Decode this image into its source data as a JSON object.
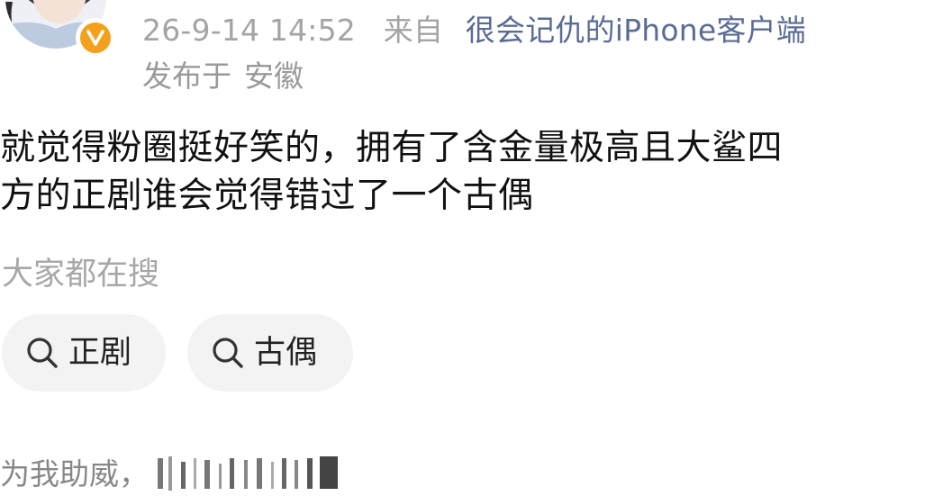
{
  "post_header": {
    "timestamp": "26-9-14 14:52",
    "from_label": "来自",
    "client": "很会记仇的iPhone客户端",
    "location_prefix": "发布于",
    "location": "安徽"
  },
  "avatar": {
    "badge_letter": "v",
    "badge_color": "#f5a01a"
  },
  "post": {
    "text_line_1": "就觉得粉圈挺好笑的，拥有了含金量极高且大鲨四",
    "text_line_2": "方的正剧谁会觉得错过了一个古偶"
  },
  "search_section": {
    "label": "大家都在搜",
    "chips": [
      {
        "label": "正剧",
        "icon": "search-icon"
      },
      {
        "label": "古偶",
        "icon": "search-icon"
      }
    ]
  },
  "footer": {
    "partial_text": "为我助威，"
  },
  "colors": {
    "link": "#5a6c95",
    "meta": "#9a9a9a",
    "chip_bg": "#f3f3f3"
  }
}
